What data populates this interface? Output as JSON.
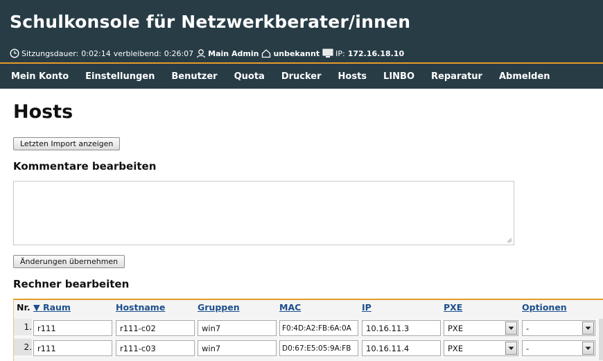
{
  "app": {
    "title": "Schulkonsole für Netzwerkberater/innen"
  },
  "status": {
    "session_label": "Sitzungsdauer:",
    "session_time": "0:02:14",
    "remaining_label": "verbleibend:",
    "remaining_time": "0:26:07",
    "user": "Main Admin",
    "room": "unbekannt",
    "ip_label": "IP:",
    "ip": "172.16.18.10"
  },
  "nav": {
    "items": [
      "Mein Konto",
      "Einstellungen",
      "Benutzer",
      "Quota",
      "Drucker",
      "Hosts",
      "LINBO",
      "Reparatur",
      "Abmelden"
    ]
  },
  "page": {
    "title": "Hosts",
    "import_button": "Letzten Import anzeigen",
    "comments_heading": "Kommentare bearbeiten",
    "comments_value": "",
    "save_button": "Änderungen übernehmen",
    "hosts_heading": "Rechner bearbeiten"
  },
  "table": {
    "headers": {
      "nr": "Nr.",
      "room": "▼ Raum",
      "hostname": "Hostname",
      "groups": "Gruppen",
      "mac": "MAC",
      "ip": "IP",
      "pxe": "PXE",
      "options": "Optionen"
    },
    "rows": [
      {
        "nr": "1.",
        "room": "r111",
        "hostname": "r111-c02",
        "group": "win7",
        "mac": "F0:4D:A2:FB:6A:0A",
        "ip": "10.16.11.3",
        "pxe": "PXE",
        "option": "-"
      },
      {
        "nr": "2.",
        "room": "r111",
        "hostname": "r111-c03",
        "group": "win7",
        "mac": "D0:67:E5:05:9A:FB",
        "ip": "10.16.11.4",
        "pxe": "PXE",
        "option": "-"
      }
    ]
  },
  "colors": {
    "header_bg": "#283c46",
    "accent_orange": "#e49a2a",
    "link_blue": "#1c4f8c"
  },
  "icons": {
    "session": "clock-icon",
    "user": "user-icon",
    "room": "house-icon",
    "ip": "monitor-icon",
    "dropdown": "chevron-down-icon"
  }
}
